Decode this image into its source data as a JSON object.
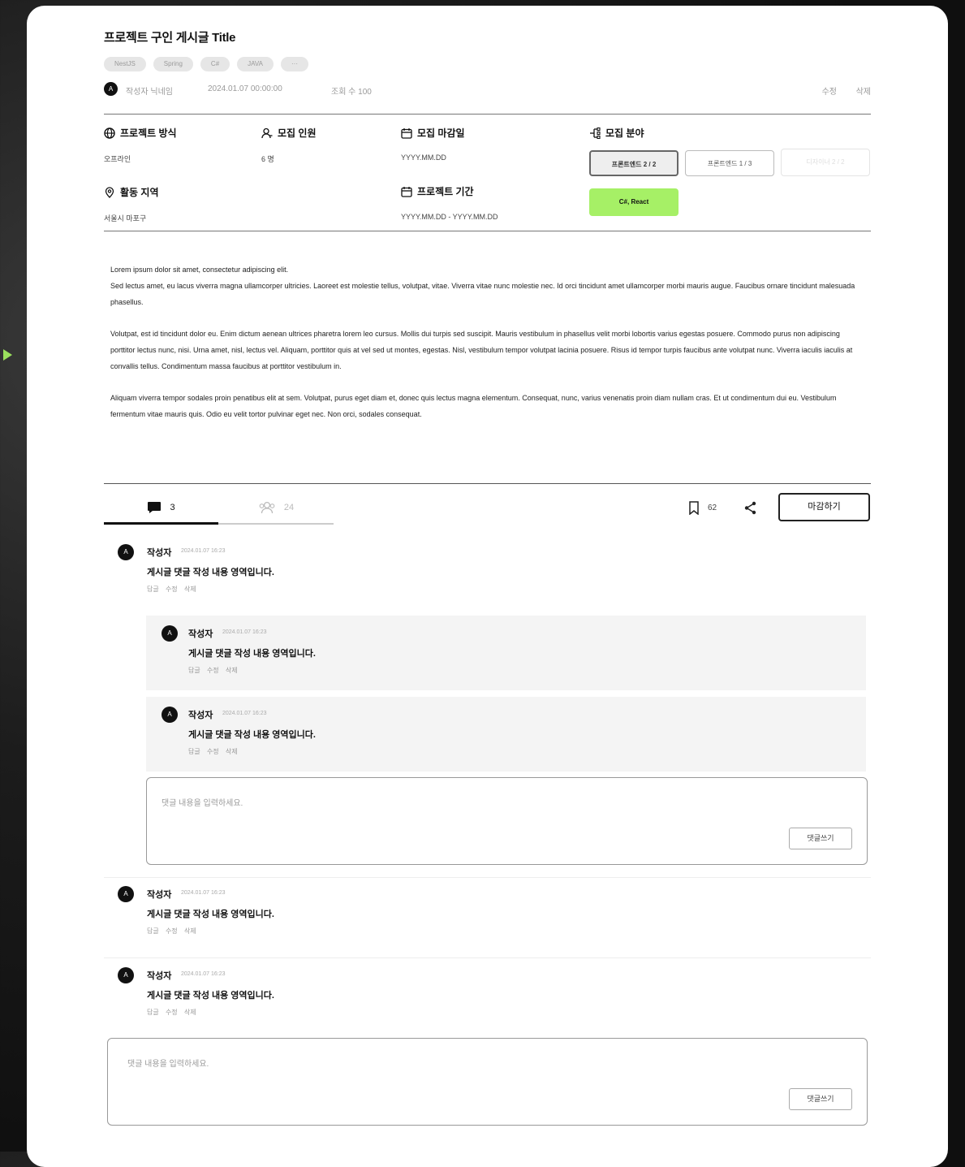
{
  "post": {
    "title": "프로젝트 구인 게시글 Title",
    "tags": [
      "NestJS",
      "Spring",
      "C#",
      "JAVA",
      "···"
    ],
    "author": {
      "avatar": "A",
      "nickname": "작성자 닉네임"
    },
    "date": "2024.01.07 00:00:00",
    "views": "조회 수 100",
    "edit_label": "수정",
    "delete_label": "삭제"
  },
  "info": {
    "method": {
      "label": "프로젝트 방식",
      "value": "오프라인",
      "icon": "globe-icon"
    },
    "members": {
      "label": "모집 인원",
      "value": "6 명",
      "icon": "person-icon"
    },
    "deadline": {
      "label": "모집 마감일",
      "value": "YYYY.MM.DD",
      "icon": "calendar-icon"
    },
    "roles": {
      "label": "모집 분야",
      "icon": "branch-icon",
      "items": [
        "프론트엔드 2 / 2",
        "프론트엔드 1 / 3",
        "디자이너 2 / 2"
      ],
      "stack": "C#, React"
    },
    "region": {
      "label": "활동 지역",
      "value": "서울시 마포구",
      "icon": "location-icon"
    },
    "period": {
      "label": "프로젝트 기간",
      "value": "YYYY.MM.DD - YYYY.MM.DD",
      "icon": "calendar-icon"
    }
  },
  "body": [
    "Lorem ipsum dolor sit amet, consectetur adipiscing elit.",
    "Sed lectus amet, eu lacus viverra magna ullamcorper ultricies. Laoreet est molestie tellus, volutpat, vitae. Viverra vitae nunc molestie nec. Id orci tincidunt amet ullamcorper morbi mauris augue. Faucibus ornare tincidunt malesuada phasellus.",
    "Volutpat, est id tincidunt dolor eu. Enim dictum aenean ultrices pharetra lorem leo cursus. Mollis dui turpis sed suscipit. Mauris vestibulum in phasellus velit morbi lobortis varius egestas posuere. Commodo purus non adipiscing porttitor lectus nunc, nisi. Urna amet, nisl, lectus vel. Aliquam, porttitor quis at vel sed ut montes, egestas. Nisl, vestibulum tempor volutpat lacinia posuere. Risus id tempor turpis faucibus ante volutpat nunc. Viverra iaculis iaculis at convallis tellus. Condimentum massa faucibus at porttitor vestibulum in.",
    "Aliquam viverra tempor sodales proin penatibus elit at sem. Volutpat, purus eget diam et, donec quis lectus magna elementum. Consequat, nunc, varius venenatis proin diam nullam cras. Et ut condimentum dui eu. Vestibulum fermentum vitae mauris quis. Odio eu velit tortor pulvinar eget nec. Non orci, sodales consequat."
  ],
  "tabs": {
    "comments_count": "3",
    "applicants_count": "24"
  },
  "actions": {
    "bookmark_count": "62",
    "apply_label": "마감하기"
  },
  "comment_template": {
    "author": "작성자",
    "avatar": "A",
    "time": "2024.01.07 16:23",
    "text": "게시글 댓글 작성 내용 영역입니다.",
    "actions": "답글 수정 삭제"
  },
  "comment_box": {
    "placeholder": "댓글 내용을 입력하세요.",
    "submit_label": "댓글쓰기"
  }
}
